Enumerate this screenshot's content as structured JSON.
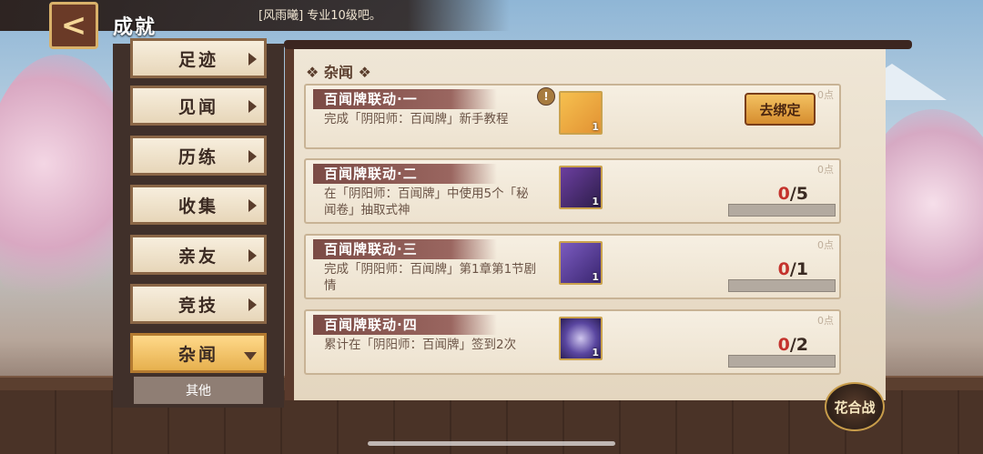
{
  "header": {
    "back_glyph": "<",
    "title": "成就",
    "chat_message": "[风雨曦] 专业10级吧。"
  },
  "sidebar": {
    "items": [
      {
        "label": "足迹",
        "active": false
      },
      {
        "label": "见闻",
        "active": false
      },
      {
        "label": "历练",
        "active": false
      },
      {
        "label": "收集",
        "active": false
      },
      {
        "label": "亲友",
        "active": false
      },
      {
        "label": "竞技",
        "active": false
      },
      {
        "label": "杂闻",
        "active": true
      }
    ],
    "sub_label": "其他"
  },
  "section": {
    "title": "❖ 杂闻 ❖"
  },
  "cards": [
    {
      "title": "百闻牌联动·一",
      "desc": "完成「阴阳师：百闻牌」新手教程",
      "points": "0点",
      "reward_qty": "1",
      "icon": "fox-cat-card-icon",
      "button_label": "去绑定",
      "warning": "!"
    },
    {
      "title": "百闻牌联动·二",
      "desc": "在「阴阳师：百闻牌」中使用5个「秘闻卷」抽取式神",
      "points": "0点",
      "reward_qty": "1",
      "icon": "group-card-icon",
      "progress_current": "0",
      "progress_total": "/5",
      "progress_fraction": 0
    },
    {
      "title": "百闻牌联动·三",
      "desc": "完成「阴阳师：百闻牌」第1章第1节剧情",
      "points": "0点",
      "reward_qty": "1",
      "icon": "fox-card-icon",
      "progress_current": "0",
      "progress_total": "/1",
      "progress_fraction": 0
    },
    {
      "title": "百闻牌联动·四",
      "desc": "累计在「阴阳师：百闻牌」签到2次",
      "points": "0点",
      "reward_qty": "1",
      "icon": "moon-card-icon",
      "progress_current": "0",
      "progress_total": "/2",
      "progress_fraction": 0
    }
  ],
  "badge": {
    "label": "花合战"
  },
  "colors": {
    "accent_red": "#c4322c",
    "active_tab": "#e6b04e",
    "panel_dark": "#5a3a2c"
  }
}
